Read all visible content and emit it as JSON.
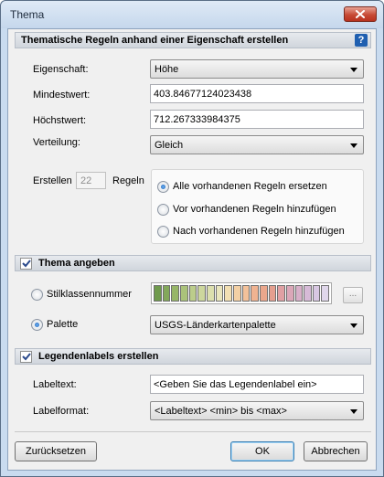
{
  "window": {
    "title": "Thema"
  },
  "section_rules": {
    "title": "Thematische Regeln anhand einer Eigenschaft erstellen",
    "property_label": "Eigenschaft:",
    "property_value": "Höhe",
    "min_label": "Mindestwert:",
    "min_value": "403.84677124023438",
    "max_label": "Höchstwert:",
    "max_value": "712.267333984375",
    "distribution_label": "Verteilung:",
    "distribution_value": "Gleich",
    "create_label": "Erstellen",
    "rules_count": "22",
    "rules_label": "Regeln",
    "options": [
      {
        "label": "Alle vorhandenen Regeln ersetzen",
        "selected": true
      },
      {
        "label": "Vor vorhandenen Regeln hinzufügen",
        "selected": false
      },
      {
        "label": "Nach vorhandenen Regeln hinzufügen",
        "selected": false
      }
    ]
  },
  "section_theme": {
    "title": "Thema angeben",
    "checked": true,
    "style_class_label": "Stilklassennummer",
    "ellipsis_label": "...",
    "palette_label": "Palette",
    "palette_value": "USGS-Länderkartenpalette",
    "ramp_colors": [
      "#6f9a4c",
      "#83a85a",
      "#97b667",
      "#aac27a",
      "#bccd8b",
      "#cdd79d",
      "#dcdfae",
      "#e9e5bd",
      "#f2dfb3",
      "#f3d0a5",
      "#f3c19a",
      "#f0b391",
      "#eba78c",
      "#e59f8f",
      "#e0a0a3",
      "#dba7b8",
      "#d8b0c9",
      "#d6bad7",
      "#d8c7e2",
      "#e0d7eb"
    ]
  },
  "section_legend": {
    "title": "Legendenlabels erstellen",
    "checked": true,
    "labeltext_label": "Labeltext:",
    "labeltext_value": "<Geben Sie das Legendenlabel ein>",
    "labelformat_label": "Labelformat:",
    "labelformat_value": "<Labeltext> <min> bis <max>"
  },
  "buttons": {
    "reset": "Zurücksetzen",
    "ok": "OK",
    "cancel": "Abbrechen"
  },
  "icons": {
    "help": "?",
    "close": "close-icon"
  },
  "colors": {
    "header_gradient_top": "#e7eaee",
    "accent": "#1f5fb0",
    "close_red": "#c74a35"
  }
}
